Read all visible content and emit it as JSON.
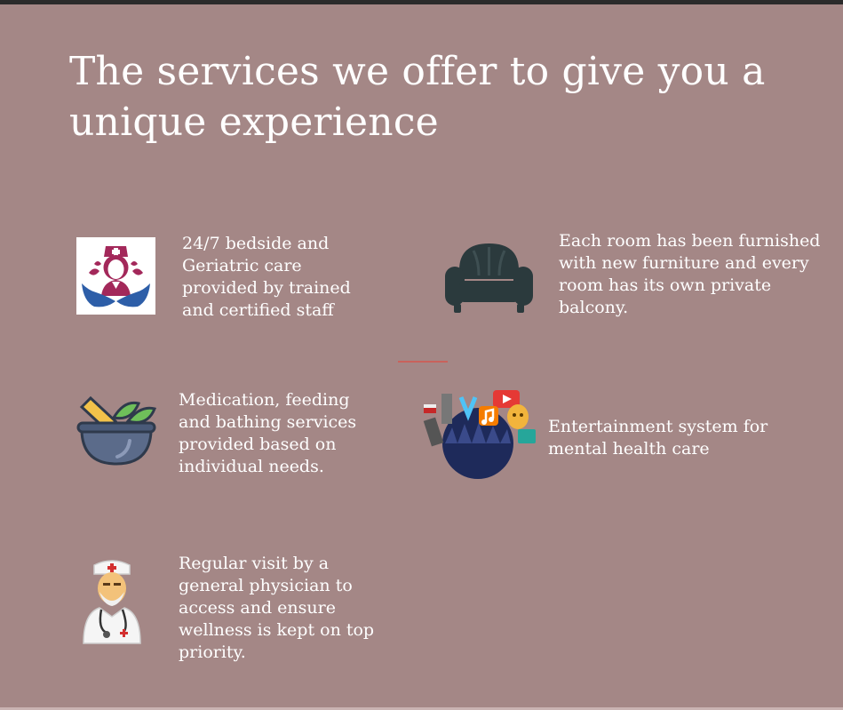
{
  "page": {
    "title": "The services we offer to give you a unique experience"
  },
  "services": [
    {
      "icon": "nurse-care-icon",
      "text": "24/7 bedside and Geriatric care provided by trained and certified staff"
    },
    {
      "icon": "sofa-icon",
      "text": "Each room has been furnished with new furniture and every room has its own private balcony."
    },
    {
      "icon": "mortar-pestle-icon",
      "text": "Medication, feeding and bathing services provided based on individual needs."
    },
    {
      "icon": "entertainment-icon",
      "text": "Entertainment system for mental health care"
    },
    {
      "icon": "doctor-icon",
      "text": "Regular visit by a general physician to access and ensure wellness is kept on top priority."
    }
  ],
  "colors": {
    "background": "#a48786",
    "text": "#ffffff",
    "divider": "#c9625c",
    "topbar": "#2b2b2b"
  }
}
